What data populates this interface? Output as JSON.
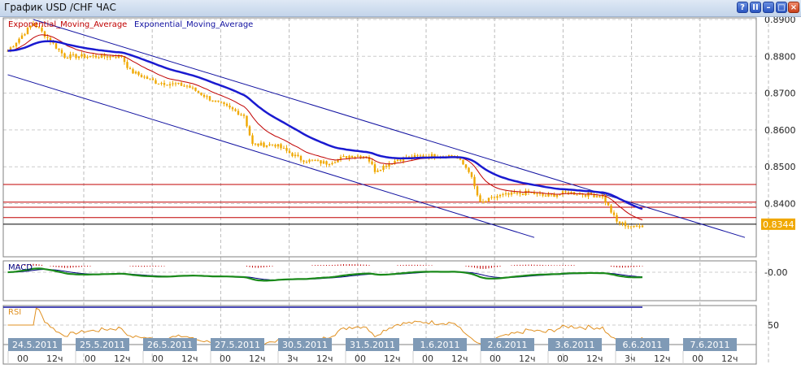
{
  "window": {
    "title": "График USD /CHF  ЧАС",
    "buttons": [
      "?",
      "II",
      "–",
      "□",
      "×"
    ]
  },
  "legend": [
    {
      "label": "Exponential_Moving_Average",
      "color": "#c00000"
    },
    {
      "label": "Exponential_Moving_Average",
      "color": "#1010a0"
    }
  ],
  "indicators": {
    "macd_label": "MACD",
    "macd_tick": "-0.00",
    "rsi_label": "RSI",
    "rsi_tick": "50"
  },
  "chart_data": {
    "type": "candlestick",
    "symbol": "USD/CHF",
    "timeframe": "ЧАС",
    "y_ticks": [
      "0.8900",
      "0.8800",
      "0.8700",
      "0.8600",
      "0.8500",
      "0.8400"
    ],
    "ylim": [
      0.8284,
      0.8949
    ],
    "last_price": "0.8344",
    "x_hours_note": "hours from 24.5.2011 00:00",
    "close_points": [
      [
        -5,
        0.8815
      ],
      [
        4,
        0.889
      ],
      [
        9,
        0.885
      ],
      [
        15,
        0.88
      ],
      [
        27,
        0.88
      ],
      [
        35,
        0.88
      ],
      [
        38,
        0.876
      ],
      [
        47,
        0.873
      ],
      [
        58,
        0.872
      ],
      [
        67,
        0.868
      ],
      [
        78,
        0.864
      ],
      [
        81,
        0.856
      ],
      [
        89,
        0.856
      ],
      [
        98,
        0.852
      ],
      [
        107,
        0.851
      ],
      [
        115,
        0.853
      ],
      [
        121,
        0.853
      ],
      [
        124,
        0.849
      ],
      [
        132,
        0.852
      ],
      [
        141,
        0.853
      ],
      [
        152,
        0.853
      ],
      [
        157,
        0.849
      ],
      [
        161,
        0.84
      ],
      [
        167,
        0.842
      ],
      [
        178,
        0.843
      ],
      [
        184,
        0.842
      ],
      [
        192,
        0.843
      ],
      [
        204,
        0.842
      ],
      [
        209,
        0.835
      ],
      [
        215,
        0.8335
      ],
      [
        218,
        0.8344
      ]
    ],
    "horizontal_levels": [
      {
        "price": 0.8452,
        "color": "#c00000"
      },
      {
        "price": 0.8404,
        "color": "#c00000"
      },
      {
        "price": 0.839,
        "color": "#c00000"
      },
      {
        "price": 0.8362,
        "color": "#c00000"
      },
      {
        "price": 0.8344,
        "color": "#000000"
      }
    ],
    "trend_lines": [
      {
        "from": [
          4,
          0.89
        ],
        "to": [
          254,
          0.8308
        ],
        "color": "#1010a0"
      },
      {
        "from": [
          -5,
          0.875
        ],
        "to": [
          180,
          0.8308
        ],
        "color": "#1010a0"
      }
    ],
    "days": [
      {
        "date": "24.5.2011",
        "a": "00",
        "b": "12ч"
      },
      {
        "date": "25.5.2011",
        "a": "00",
        "b": "12ч"
      },
      {
        "date": "26.5.2011",
        "a": "00",
        "b": "12ч"
      },
      {
        "date": "27.5.2011",
        "a": "00",
        "b": "12ч"
      },
      {
        "date": "30.5.2011",
        "a": "3ч",
        "b": "12ч"
      },
      {
        "date": "31.5.2011",
        "a": "00",
        "b": "12ч"
      },
      {
        "date": "1.6.2011",
        "a": "00",
        "b": "12ч"
      },
      {
        "date": "2.6.2011",
        "a": "00",
        "b": "12ч"
      },
      {
        "date": "3.6.2011",
        "a": "00",
        "b": "12ч"
      },
      {
        "date": "6.6.2011",
        "a": "3ч",
        "b": "12ч"
      },
      {
        "date": "7.6.2011",
        "a": "00",
        "b": "12ч"
      }
    ],
    "colors": {
      "candle": "#f0a800",
      "ema_fast": "#c00000",
      "ema_slow": "#1a1ad0",
      "macd": "#1a8a1a",
      "signal": "#000080",
      "rsi": "#e09020"
    }
  }
}
